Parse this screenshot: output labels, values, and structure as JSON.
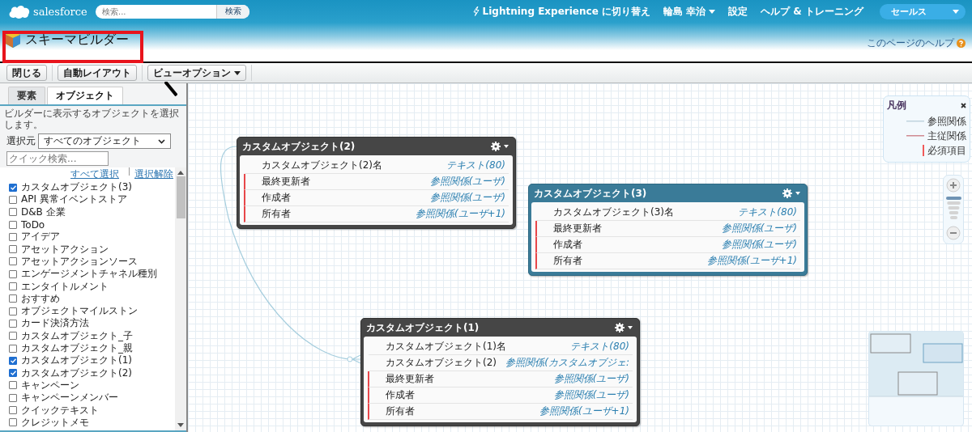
{
  "header": {
    "logo_text": "salesforce",
    "search": {
      "placeholder": "検索..."
    },
    "search_button": "検索",
    "lightning_link": "Lightning Experience に切り替え",
    "user_menu": "輪島 幸治",
    "nav_links": [
      "設定",
      "ヘルプ & トレーニング"
    ],
    "app_menu": "セールス"
  },
  "page": {
    "title": "スキーマビルダー",
    "help_link": "このページのヘルプ"
  },
  "toolbar": {
    "buttons": [
      {
        "label": "閉じる",
        "has_menu": false
      },
      {
        "label": "自動レイアウト",
        "has_menu": false
      },
      {
        "label": "ビューオプション",
        "has_menu": true
      }
    ]
  },
  "sidebar": {
    "tabs": [
      {
        "label": "要素",
        "selected": false
      },
      {
        "label": "オブジェクト",
        "selected": true
      }
    ],
    "description": "ビルダーに表示するオブジェクトを選択します。",
    "filter_label": "選択元",
    "filter_value": "すべてのオブジェクト",
    "quick_search": {
      "placeholder": "クイック検索..."
    },
    "select_all": "すべて選択",
    "deselect_all": "選択解除",
    "objects": [
      {
        "label": "カスタムオブジェクト(3)",
        "checked": true
      },
      {
        "label": "API 異常イベントストア",
        "checked": false
      },
      {
        "label": "D&B 企業",
        "checked": false
      },
      {
        "label": "ToDo",
        "checked": false
      },
      {
        "label": "アイデア",
        "checked": false
      },
      {
        "label": "アセットアクション",
        "checked": false
      },
      {
        "label": "アセットアクションソース",
        "checked": false
      },
      {
        "label": "エンゲージメントチャネル種別",
        "checked": false
      },
      {
        "label": "エンタイトルメント",
        "checked": false
      },
      {
        "label": "おすすめ",
        "checked": false
      },
      {
        "label": "オブジェクトマイルストン",
        "checked": false
      },
      {
        "label": "カード決済方法",
        "checked": false
      },
      {
        "label": "カスタムオブジェクト_子",
        "checked": false
      },
      {
        "label": "カスタムオブジェクト_親",
        "checked": false
      },
      {
        "label": "カスタムオブジェクト(1)",
        "checked": true
      },
      {
        "label": "カスタムオブジェクト(2)",
        "checked": true
      },
      {
        "label": "キャンペーン",
        "checked": false
      },
      {
        "label": "キャンペーンメンバー",
        "checked": false
      },
      {
        "label": "クイックテキスト",
        "checked": false
      },
      {
        "label": "クレジットメモ",
        "checked": false
      }
    ]
  },
  "canvas": {
    "nodes": [
      {
        "title": "カスタムオブジェクト(2)",
        "selected": false,
        "fields": [
          {
            "name": "カスタムオブジェクト(2)名",
            "type": "テキスト(80)",
            "required": false
          },
          {
            "name": "最終更新者",
            "type": "参照関係(ユーザ)",
            "required": true
          },
          {
            "name": "作成者",
            "type": "参照関係(ユーザ)",
            "required": true
          },
          {
            "name": "所有者",
            "type": "参照関係(ユーザ+1)",
            "required": true
          }
        ]
      },
      {
        "title": "カスタムオブジェクト(3)",
        "selected": true,
        "fields": [
          {
            "name": "カスタムオブジェクト(3)名",
            "type": "テキスト(80)",
            "required": false
          },
          {
            "name": "最終更新者",
            "type": "参照関係(ユーザ)",
            "required": true
          },
          {
            "name": "作成者",
            "type": "参照関係(ユーザ)",
            "required": true
          },
          {
            "name": "所有者",
            "type": "参照関係(ユーザ+1)",
            "required": true
          }
        ]
      },
      {
        "title": "カスタムオブジェクト(1)",
        "selected": false,
        "fields": [
          {
            "name": "カスタムオブジェクト(1)名",
            "type": "テキスト(80)",
            "required": false
          },
          {
            "name": "カスタムオブジェクト(2)",
            "type": "参照関係(カスタムオブジェ:",
            "required": false
          },
          {
            "name": "最終更新者",
            "type": "参照関係(ユーザ)",
            "required": true
          },
          {
            "name": "作成者",
            "type": "参照関係(ユーザ)",
            "required": true
          },
          {
            "name": "所有者",
            "type": "参照関係(ユーザ+1)",
            "required": true
          }
        ]
      }
    ],
    "legend": {
      "title": "凡例",
      "items": [
        {
          "kind": "lookup",
          "label": "参照関係"
        },
        {
          "kind": "master_detail",
          "label": "主従関係"
        },
        {
          "kind": "required",
          "label": "必須項目"
        }
      ]
    },
    "zoom": {
      "level": 1
    }
  }
}
